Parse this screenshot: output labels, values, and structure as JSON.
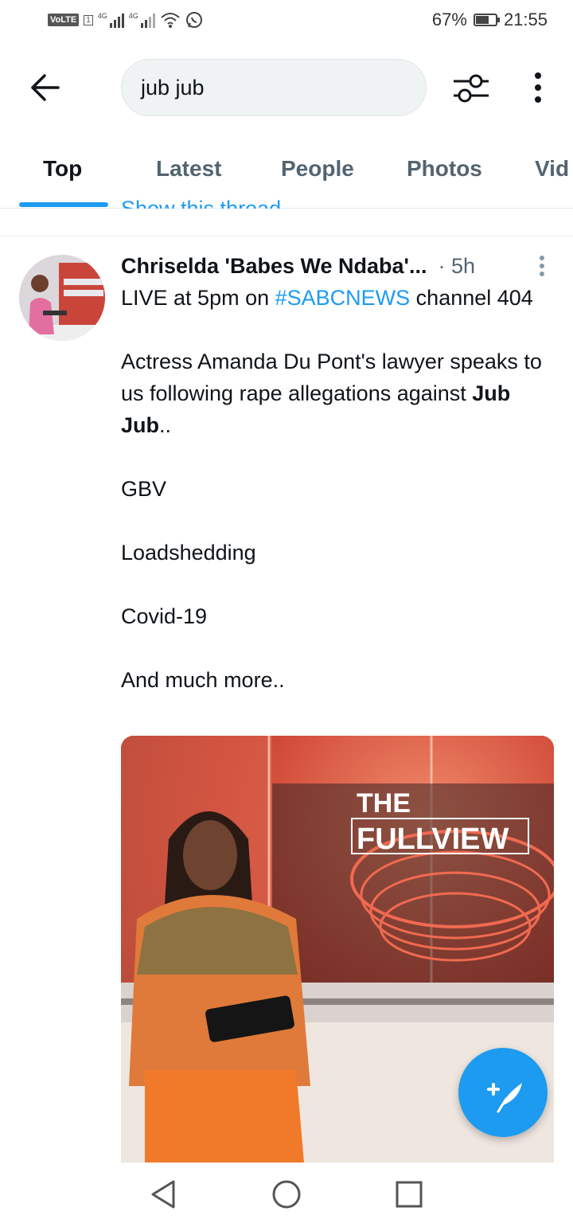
{
  "status_bar": {
    "volte": "VoLTE",
    "sim": "1",
    "network1": "4G",
    "network2": "4G",
    "battery": "67%",
    "time": "21:55",
    "icons": [
      "signal-icon",
      "wifi-icon",
      "whatsapp-icon",
      "battery-icon"
    ]
  },
  "search": {
    "query": "jub jub"
  },
  "tabs": [
    {
      "label": "Top",
      "active": true
    },
    {
      "label": "Latest"
    },
    {
      "label": "People"
    },
    {
      "label": "Photos"
    },
    {
      "label": "Vid"
    }
  ],
  "previous_tweet": {
    "link": "Show this thread"
  },
  "tweet": {
    "author": "Chriselda 'Babes We Ndaba'...",
    "time": "5h",
    "line1_pre": "LIVE at 5pm on ",
    "hashtag": "#SABCNEWS",
    "line1_post": " channel 404",
    "para2_pre": "Actress Amanda Du Pont's lawyer speaks to us following rape allegations against ",
    "para2_bold": "Jub Jub",
    "para2_post": "..",
    "para3": "GBV",
    "para4": "Loadshedding",
    "para5": "Covid-19",
    "para6": "And much more..",
    "media_text": [
      "THE",
      "FULLVIEW"
    ]
  },
  "colors": {
    "accent": "#1d9bf0",
    "secondary_text": "#536471"
  }
}
